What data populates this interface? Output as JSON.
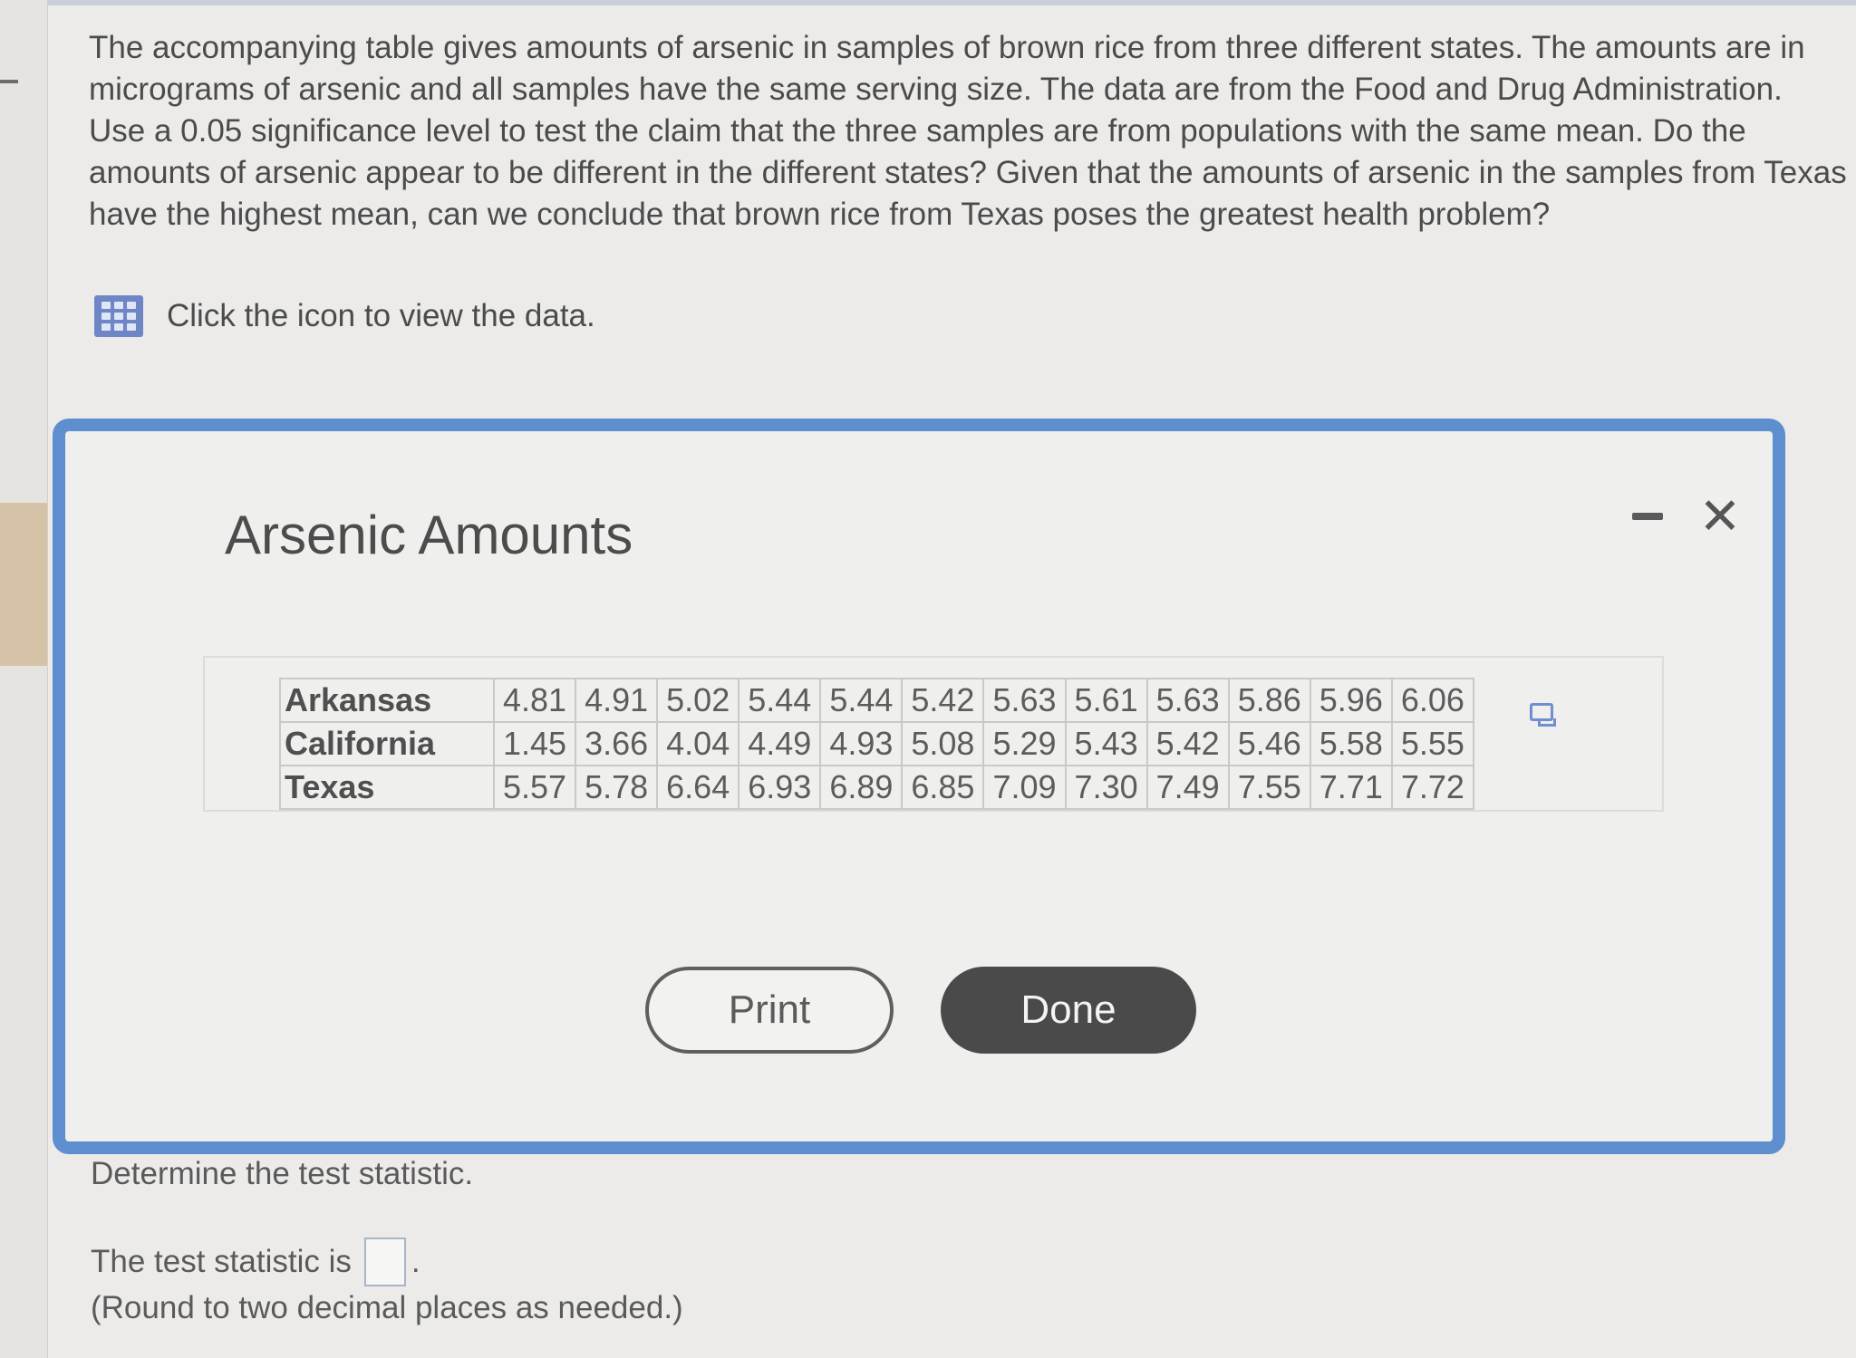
{
  "question": {
    "text": "The accompanying table gives amounts of arsenic in samples of brown rice from three different states. The amounts are in micrograms of arsenic and all samples have the same serving size. The data are from the Food and Drug Administration. Use a 0.05 significance level to test the claim that the three samples are from populations with the same mean. Do the amounts of arsenic appear to be different in the different states? Given that the amounts of arsenic in the samples from Texas have the highest mean, can we conclude that brown rice from Texas poses the greatest health problem?",
    "view_data_label": "Click the icon to view the data.",
    "view_data_icon": "data-table-icon"
  },
  "dialog": {
    "title": "Arsenic Amounts",
    "minimize_icon": "minimize-icon",
    "close_icon": "close-icon",
    "close_glyph": "✕",
    "rows": [
      {
        "label": "Arkansas",
        "values": [
          "4.81",
          "4.91",
          "5.02",
          "5.44",
          "5.44",
          "5.42",
          "5.63",
          "5.61",
          "5.63",
          "5.86",
          "5.96",
          "6.06"
        ]
      },
      {
        "label": "California",
        "values": [
          "1.45",
          "3.66",
          "4.04",
          "4.49",
          "4.93",
          "5.08",
          "5.29",
          "5.43",
          "5.42",
          "5.46",
          "5.58",
          "5.55"
        ]
      },
      {
        "label": "Texas",
        "values": [
          "5.57",
          "5.78",
          "6.64",
          "6.93",
          "6.89",
          "6.85",
          "7.09",
          "7.30",
          "7.49",
          "7.55",
          "7.71",
          "7.72"
        ]
      }
    ],
    "copy_icon": "copy-icon",
    "print_label": "Print",
    "done_label": "Done"
  },
  "answer": {
    "prompt": "Determine the test statistic.",
    "statistic_label": "The test statistic is",
    "statistic_value": "",
    "trailing": ".",
    "note": "(Round to two decimal places as needed.)"
  },
  "colors": {
    "dialog_border": "#5d8fcf",
    "icon_blue": "#6f86c6",
    "done_button": "#4a4a4a"
  }
}
